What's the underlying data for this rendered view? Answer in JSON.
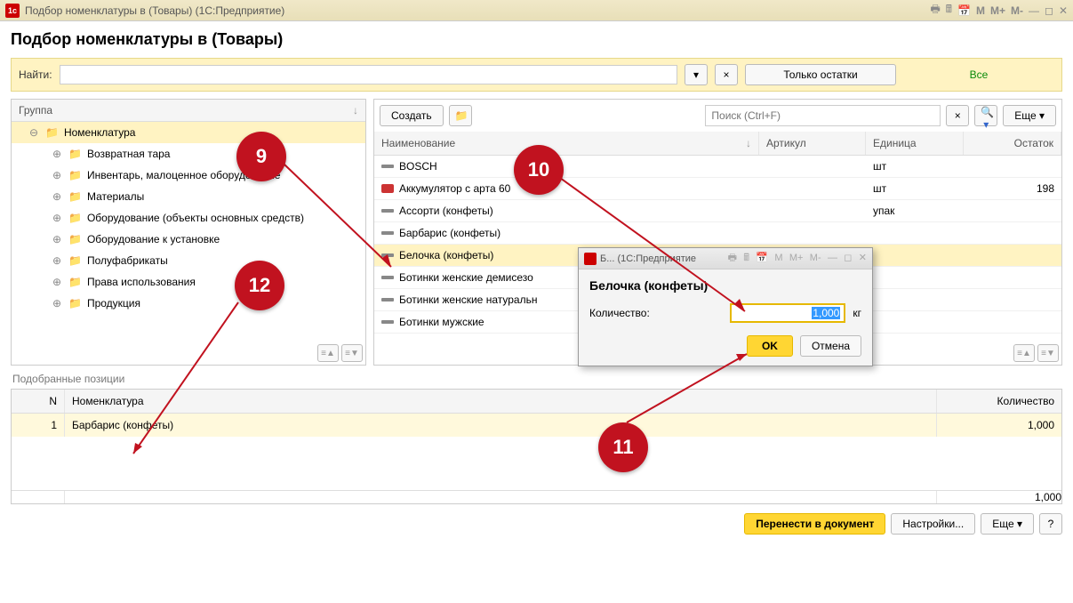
{
  "window": {
    "title": "Подбор номенклатуры в  (Товары)  (1С:Предприятие)"
  },
  "page_title": "Подбор номенклатуры в  (Товары)",
  "search": {
    "label": "Найти:",
    "value": ""
  },
  "filter": {
    "only_stock": "Только остатки",
    "all": "Все",
    "clear": "×"
  },
  "tree": {
    "header": "Группа",
    "root": "Номенклатура",
    "items": [
      "Возвратная тара",
      "Инвентарь, малоценное оборудование",
      "Материалы",
      "Оборудование (объекты основных средств)",
      "Оборудование к установке",
      "Полуфабрикаты",
      "Права использования",
      "Продукция"
    ]
  },
  "list": {
    "create": "Создать",
    "search_placeholder": "Поиск (Ctrl+F)",
    "more": "Еще",
    "cols": {
      "name": "Наименование",
      "article": "Артикул",
      "unit": "Единица",
      "stock": "Остаток"
    },
    "rows": [
      {
        "name": "BOSCH",
        "unit": "шт",
        "stock": ""
      },
      {
        "name": "Аккумулятор с               арта 60",
        "unit": "шт",
        "stock": "198",
        "icon": "red"
      },
      {
        "name": "Ассорти (конфеты)",
        "unit": "упак",
        "stock": ""
      },
      {
        "name": "Барбарис (конфеты)",
        "unit": "",
        "stock": ""
      },
      {
        "name": "Белочка (конфеты)",
        "unit": "",
        "stock": "",
        "selected": true
      },
      {
        "name": "Ботинки женские демисезо",
        "unit": "",
        "stock": ""
      },
      {
        "name": "Ботинки женские натуральн",
        "unit": "",
        "stock": ""
      },
      {
        "name": "Ботинки мужские",
        "unit": "",
        "stock": ""
      }
    ]
  },
  "picked": {
    "label": "Подобранные позиции",
    "cols": {
      "n": "N",
      "nom": "Номенклатура",
      "qty": "Количество"
    },
    "rows": [
      {
        "n": "1",
        "nom": "Барбарис (конфеты)",
        "qty": "1,000"
      }
    ],
    "total": "1,000"
  },
  "bottom": {
    "transfer": "Перенести в документ",
    "settings": "Настройки...",
    "more": "Еще",
    "help": "?"
  },
  "dialog": {
    "title": "Б...  (1С:Предприятие",
    "item_name": "Белочка (конфеты)",
    "qty_label": "Количество:",
    "qty_value": "1,000",
    "unit": "кг",
    "ok": "OK",
    "cancel": "Отмена"
  },
  "annotations": {
    "a9": "9",
    "a10": "10",
    "a11": "11",
    "a12": "12"
  }
}
